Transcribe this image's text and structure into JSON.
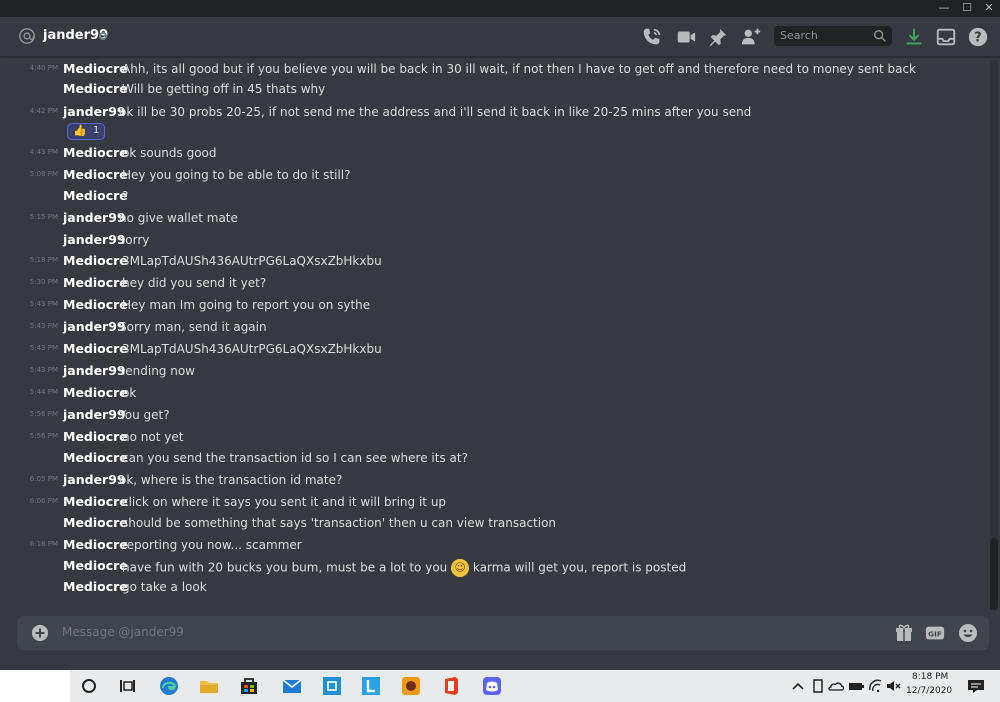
{
  "window": {
    "controls": [
      "—",
      "☐",
      "✕"
    ]
  },
  "header": {
    "username": "jander99",
    "search_placeholder": "Search"
  },
  "messages": [
    {
      "time": "4:40 PM",
      "author": "Mediocre",
      "text": "Ahh, its all good but if you believe you will be back in 30 ill wait, if not then I have to get off and therefore need to money sent back"
    },
    {
      "time": "",
      "author": "Mediocre",
      "text": "Will be getting off in 45 thats why"
    },
    {
      "time": "4:42 PM",
      "author": "jander99",
      "text": "ok ill be 30 probs 20-25, if not send me the address and i'll send it back in like 20-25 mins after you send"
    },
    {
      "time": "4:43 PM",
      "author": "Mediocre",
      "text": "ok sounds good"
    },
    {
      "time": "5:08 PM",
      "author": "Mediocre",
      "text": "Hey you going to be able to do it still?"
    },
    {
      "time": "",
      "author": "Mediocre",
      "text": "?"
    },
    {
      "time": "5:15 PM",
      "author": "jander99",
      "text": "no give wallet mate"
    },
    {
      "time": "",
      "author": "jander99",
      "text": "sorry"
    },
    {
      "time": "5:18 PM",
      "author": "Mediocre",
      "text": "3MLapTdAUSh436AUtrPG6LaQXsxZbHkxbu"
    },
    {
      "time": "5:30 PM",
      "author": "Mediocre",
      "text": "hey did you send it yet?"
    },
    {
      "time": "5:43 PM",
      "author": "Mediocre",
      "text": "Hey man Im going to report you on sythe"
    },
    {
      "time": "5:43 PM",
      "author": "jander99",
      "text": "Sorry man, send it again"
    },
    {
      "time": "5:43 PM",
      "author": "Mediocre",
      "text": "3MLapTdAUSh436AUtrPG6LaQXsxZbHkxbu"
    },
    {
      "time": "5:43 PM",
      "author": "jander99",
      "text": "sending now"
    },
    {
      "time": "5:44 PM",
      "author": "Mediocre",
      "text": "ok"
    },
    {
      "time": "5:56 PM",
      "author": "jander99",
      "text": "You get?"
    },
    {
      "time": "5:56 PM",
      "author": "Mediocre",
      "text": "no not yet"
    },
    {
      "time": "",
      "author": "Mediocre",
      "text": "can you send the transaction id so I can see where its at?"
    },
    {
      "time": "6:05 PM",
      "author": "jander99",
      "text": "ok, where is the transaction id mate?"
    },
    {
      "time": "6:06 PM",
      "author": "Mediocre",
      "text": "click on where it says you sent it and it will bring it up"
    },
    {
      "time": "",
      "author": "Mediocre",
      "text": "should be something that says 'transaction' then u can view transaction"
    },
    {
      "time": "6:18 PM",
      "author": "Mediocre",
      "text": "reporting you now... scammer"
    },
    {
      "time": "",
      "author": "Mediocre",
      "text": "have fun with 20 bucks you bum, must be a lot to you",
      "emoji": "winking-face",
      "text_after": "karma will get you, report is posted"
    },
    {
      "time": "",
      "author": "Mediocre",
      "text": "go take a look"
    }
  ],
  "reaction": {
    "emoji": "thumbs-up",
    "count": "1"
  },
  "composer": {
    "placeholder": "Message @jander99",
    "gif_label": "GIF"
  },
  "taskbar": {
    "time": "8:18 PM",
    "date": "12/7/2020"
  },
  "colors": {
    "background": "#36393f",
    "header_bg": "#36393f",
    "composer_bg": "#40444b",
    "titlebar_bg": "#202225",
    "accent": "#5865f2",
    "taskbar_bg": "#e9eaec"
  }
}
